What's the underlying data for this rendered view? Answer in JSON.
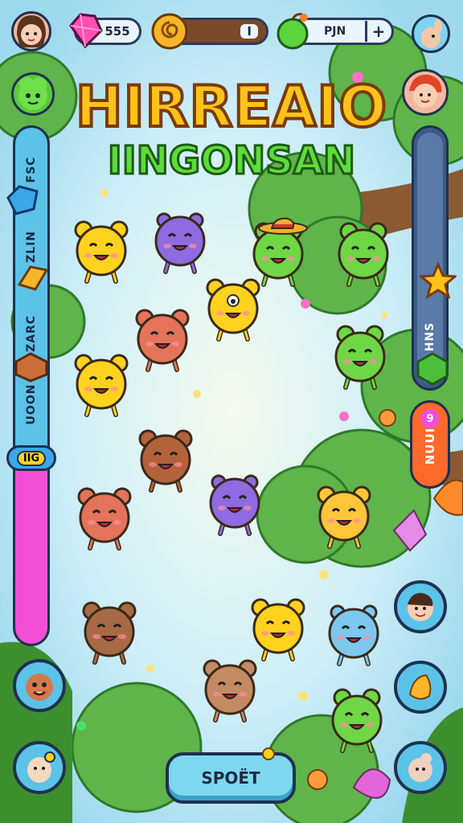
{
  "topbar": {
    "gems_value": "555",
    "coins_value": "I",
    "energy_value": "PJN",
    "plus_symbol": "+"
  },
  "title": {
    "line1": "HIRREAIO",
    "line2": "IINGONSAN"
  },
  "left_sidebar": {
    "labels": [
      "FSC",
      "ZLIN",
      "ZARC",
      "UOON"
    ],
    "badge": "IIG"
  },
  "right_sidebar": {
    "labels": [
      "HNS",
      "NUUI"
    ],
    "pink_badge": "9"
  },
  "bottom_button": {
    "label": "SPOËT"
  },
  "colors": {
    "sky": "#bfe8f5",
    "grass": "#56b33a",
    "sidebar_blue": "#4fb6e0",
    "sidebar_pink": "#f24fd6",
    "title_yellow": "#ffc21a",
    "title_green": "#5fdc3c"
  },
  "creatures": [
    {
      "color": "#ffd21f",
      "kind": "bear"
    },
    {
      "color": "#8e6be0",
      "kind": "blob"
    },
    {
      "color": "#6fd646",
      "kind": "frog-hat"
    },
    {
      "color": "#6fd646",
      "kind": "frog"
    },
    {
      "color": "#e4735a",
      "kind": "bear"
    },
    {
      "color": "#ffd21f",
      "kind": "one-eye"
    },
    {
      "color": "#ffd21f",
      "kind": "bear"
    },
    {
      "color": "#6fd646",
      "kind": "frog"
    },
    {
      "color": "#b4623a",
      "kind": "bear"
    },
    {
      "color": "#8e6be0",
      "kind": "blob"
    },
    {
      "color": "#e4735a",
      "kind": "bear"
    },
    {
      "color": "#ffc63a",
      "kind": "bear"
    },
    {
      "color": "#a76a44",
      "kind": "bear"
    },
    {
      "color": "#ffd21f",
      "kind": "bear"
    },
    {
      "color": "#7ec8ef",
      "kind": "blob"
    },
    {
      "color": "#c48a62",
      "kind": "bear"
    },
    {
      "color": "#6fd646",
      "kind": "frog"
    }
  ],
  "icons": [
    "gem-icon",
    "coin-icon",
    "apple-icon",
    "plus-icon",
    "crystal-icon",
    "gold-bar-icon",
    "dirt-block-icon",
    "star-icon",
    "green-cube-icon",
    "flower-icon"
  ]
}
